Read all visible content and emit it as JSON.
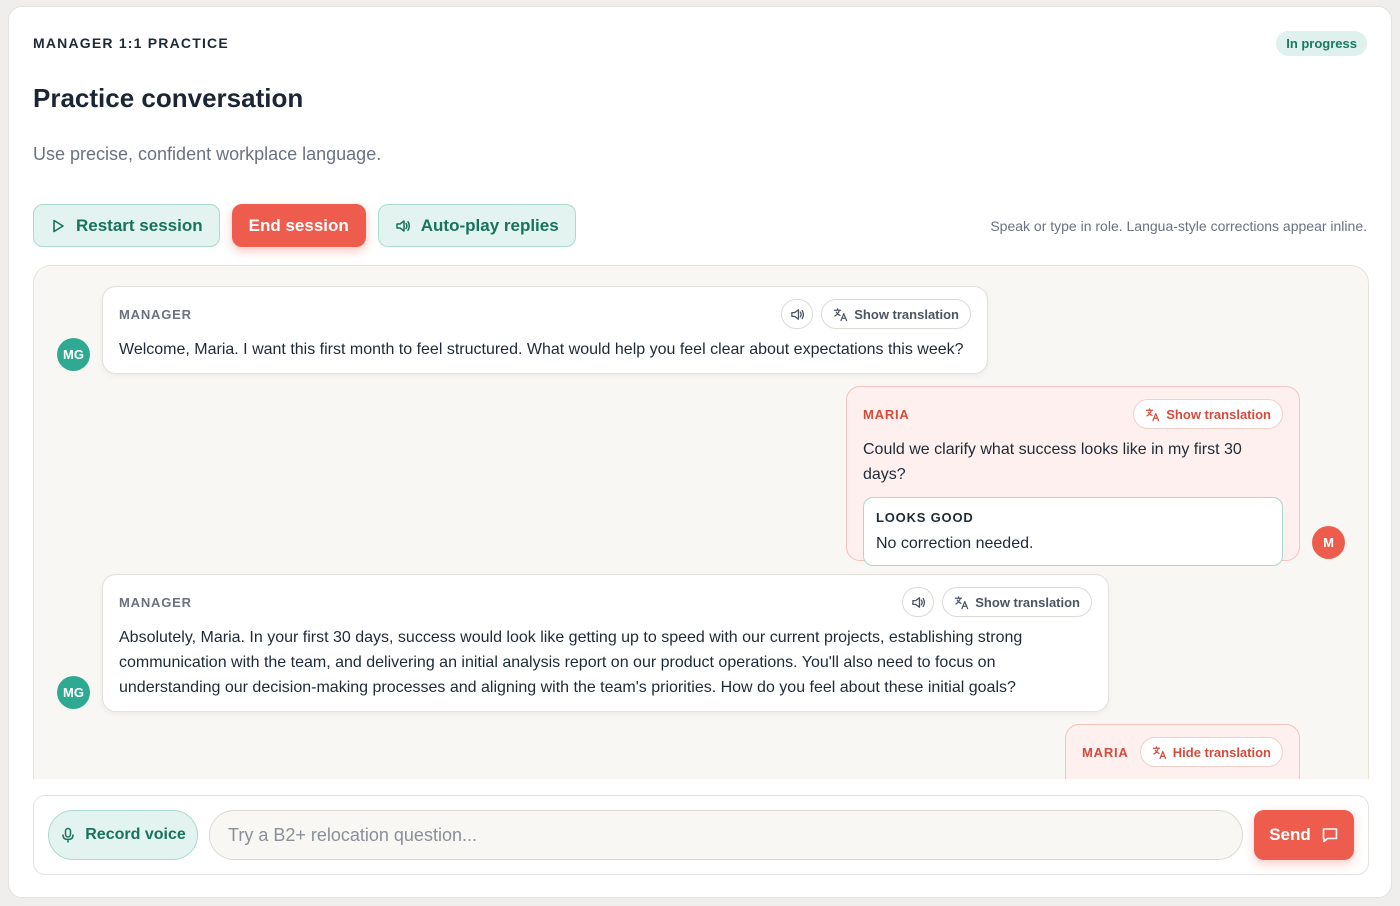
{
  "header": {
    "kicker": "MANAGER 1:1 PRACTICE",
    "status": "In progress",
    "title": "Practice conversation",
    "subtitle": "Use precise, confident workplace language."
  },
  "toolbar": {
    "restart_label": "Restart session",
    "end_label": "End session",
    "autoplay_label": "Auto-play replies",
    "hint": "Speak or type in role. Langua-style corrections appear inline."
  },
  "messages": [
    {
      "role": "MANAGER",
      "avatar": "MG",
      "translation_label": "Show translation",
      "text": "Welcome, Maria. I want this first month to feel structured. What would help you feel clear about expectations this week?"
    },
    {
      "role": "MARIA",
      "avatar": "M",
      "translation_label": "Show translation",
      "text": "Could we clarify what success looks like in my first 30 days?",
      "correction": {
        "label": "LOOKS GOOD",
        "text": "No correction needed."
      }
    },
    {
      "role": "MANAGER",
      "avatar": "MG",
      "translation_label": "Show translation",
      "text": "Absolutely, Maria. In your first 30 days, success would look like getting up to speed with our current projects, establishing strong communication with the team, and delivering an initial analysis report on our product operations. You'll also need to focus on understanding our decision-making processes and aligning with the team's priorities. How do you feel about these initial goals?"
    },
    {
      "role": "MARIA",
      "translation_label": "Hide translation"
    }
  ],
  "composer": {
    "record_label": "Record voice",
    "placeholder": "Try a B2+ relocation question...",
    "value": "",
    "send_label": "Send"
  },
  "colors": {
    "accent_teal": "#17735c",
    "accent_red": "#ee5c4d",
    "teal_soft": "#e3f3ef",
    "user_bubble": "#fdf0ee"
  },
  "icons": {
    "restart": "play-icon",
    "autoplay": "speaker-icon",
    "translate": "translate-icon",
    "record": "microphone-icon",
    "send": "chat-bubble-icon"
  }
}
